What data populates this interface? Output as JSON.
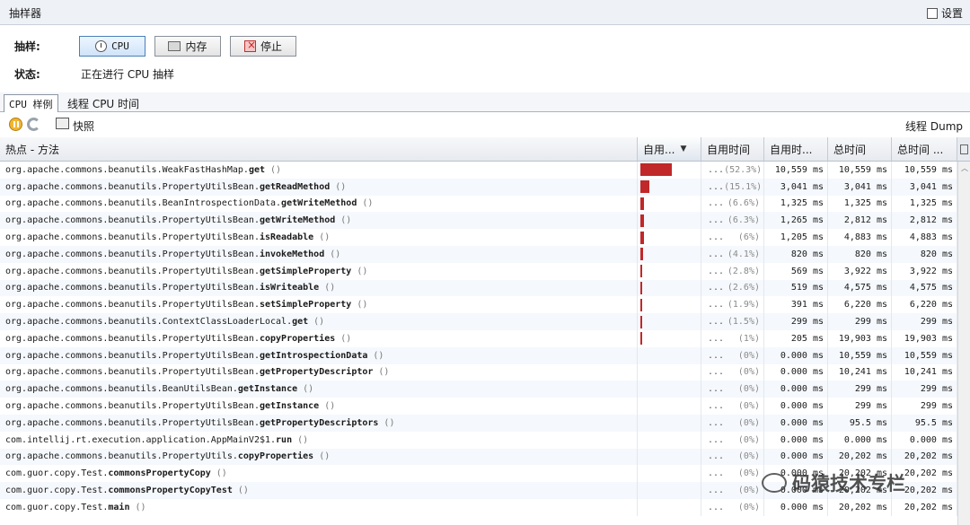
{
  "window": {
    "title": "抽样器",
    "settings_label": "设置"
  },
  "controls": {
    "sampling_label": "抽样:",
    "cpu_button": "CPU",
    "memory_button": "内存",
    "stop_button": "停止",
    "status_label": "状态:",
    "status_value": "正在进行 CPU 抽样"
  },
  "tabs": [
    {
      "label": "CPU 样例",
      "selected": true
    },
    {
      "label": "线程 CPU 时间",
      "selected": false
    }
  ],
  "toolbar": {
    "snapshot_label": "快照",
    "thread_dump_label": "线程 Dump"
  },
  "table": {
    "columns": [
      "热点 - 方法",
      "自用...",
      "自用时间",
      "自用时...",
      "总时间",
      "总时间 ..."
    ],
    "sorted_column": 1,
    "rows": [
      {
        "prefix": "org.apache.commons.beanutils.WeakFastHashMap.",
        "method": "get",
        "pct": "(52.3%)",
        "bar_fraction": 0.523,
        "self_time": "10,559 ms",
        "total_time": "10,559 ms",
        "total_time2": "10,559 ms"
      },
      {
        "prefix": "org.apache.commons.beanutils.PropertyUtilsBean.",
        "method": "getReadMethod",
        "pct": "(15.1%)",
        "bar_fraction": 0.151,
        "self_time": "3,041 ms",
        "total_time": "3,041 ms",
        "total_time2": "3,041 ms"
      },
      {
        "prefix": "org.apache.commons.beanutils.BeanIntrospectionData.",
        "method": "getWriteMethod",
        "pct": "(6.6%)",
        "bar_fraction": 0.066,
        "self_time": "1,325 ms",
        "total_time": "1,325 ms",
        "total_time2": "1,325 ms"
      },
      {
        "prefix": "org.apache.commons.beanutils.PropertyUtilsBean.",
        "method": "getWriteMethod",
        "pct": "(6.3%)",
        "bar_fraction": 0.063,
        "self_time": "1,265 ms",
        "total_time": "2,812 ms",
        "total_time2": "2,812 ms"
      },
      {
        "prefix": "org.apache.commons.beanutils.PropertyUtilsBean.",
        "method": "isReadable",
        "pct": "(6%)",
        "bar_fraction": 0.06,
        "self_time": "1,205 ms",
        "total_time": "4,883 ms",
        "total_time2": "4,883 ms"
      },
      {
        "prefix": "org.apache.commons.beanutils.PropertyUtilsBean.",
        "method": "invokeMethod",
        "pct": "(4.1%)",
        "bar_fraction": 0.041,
        "self_time": "820 ms",
        "total_time": "820 ms",
        "total_time2": "820 ms"
      },
      {
        "prefix": "org.apache.commons.beanutils.PropertyUtilsBean.",
        "method": "getSimpleProperty",
        "pct": "(2.8%)",
        "bar_fraction": 0.028,
        "self_time": "569 ms",
        "total_time": "3,922 ms",
        "total_time2": "3,922 ms"
      },
      {
        "prefix": "org.apache.commons.beanutils.PropertyUtilsBean.",
        "method": "isWriteable",
        "pct": "(2.6%)",
        "bar_fraction": 0.026,
        "self_time": "519 ms",
        "total_time": "4,575 ms",
        "total_time2": "4,575 ms"
      },
      {
        "prefix": "org.apache.commons.beanutils.PropertyUtilsBean.",
        "method": "setSimpleProperty",
        "pct": "(1.9%)",
        "bar_fraction": 0.019,
        "self_time": "391 ms",
        "total_time": "6,220 ms",
        "total_time2": "6,220 ms"
      },
      {
        "prefix": "org.apache.commons.beanutils.ContextClassLoaderLocal.",
        "method": "get",
        "pct": "(1.5%)",
        "bar_fraction": 0.015,
        "self_time": "299 ms",
        "total_time": "299 ms",
        "total_time2": "299 ms"
      },
      {
        "prefix": "org.apache.commons.beanutils.PropertyUtilsBean.",
        "method": "copyProperties",
        "pct": "(1%)",
        "bar_fraction": 0.01,
        "self_time": "205 ms",
        "total_time": "19,903 ms",
        "total_time2": "19,903 ms"
      },
      {
        "prefix": "org.apache.commons.beanutils.PropertyUtilsBean.",
        "method": "getIntrospectionData",
        "pct": "(0%)",
        "bar_fraction": 0,
        "self_time": "0.000 ms",
        "total_time": "10,559 ms",
        "total_time2": "10,559 ms"
      },
      {
        "prefix": "org.apache.commons.beanutils.PropertyUtilsBean.",
        "method": "getPropertyDescriptor",
        "pct": "(0%)",
        "bar_fraction": 0,
        "self_time": "0.000 ms",
        "total_time": "10,241 ms",
        "total_time2": "10,241 ms"
      },
      {
        "prefix": "org.apache.commons.beanutils.BeanUtilsBean.",
        "method": "getInstance",
        "pct": "(0%)",
        "bar_fraction": 0,
        "self_time": "0.000 ms",
        "total_time": "299 ms",
        "total_time2": "299 ms"
      },
      {
        "prefix": "org.apache.commons.beanutils.PropertyUtilsBean.",
        "method": "getInstance",
        "pct": "(0%)",
        "bar_fraction": 0,
        "self_time": "0.000 ms",
        "total_time": "299 ms",
        "total_time2": "299 ms"
      },
      {
        "prefix": "org.apache.commons.beanutils.PropertyUtilsBean.",
        "method": "getPropertyDescriptors",
        "pct": "(0%)",
        "bar_fraction": 0,
        "self_time": "0.000 ms",
        "total_time": "95.5 ms",
        "total_time2": "95.5 ms"
      },
      {
        "prefix": "com.intellij.rt.execution.application.AppMainV2$1.",
        "method": "run",
        "pct": "(0%)",
        "bar_fraction": 0,
        "self_time": "0.000 ms",
        "total_time": "0.000 ms",
        "total_time2": "0.000 ms"
      },
      {
        "prefix": "org.apache.commons.beanutils.PropertyUtils.",
        "method": "copyProperties",
        "pct": "(0%)",
        "bar_fraction": 0,
        "self_time": "0.000 ms",
        "total_time": "20,202 ms",
        "total_time2": "20,202 ms"
      },
      {
        "prefix": "com.guor.copy.Test.",
        "method": "commonsPropertyCopy",
        "pct": "(0%)",
        "bar_fraction": 0,
        "self_time": "0.000 ms",
        "total_time": "20,202 ms",
        "total_time2": "20,202 ms"
      },
      {
        "prefix": "com.guor.copy.Test.",
        "method": "commonsPropertyCopyTest",
        "pct": "(0%)",
        "bar_fraction": 0,
        "self_time": "0.000 ms",
        "total_time": "20,202 ms",
        "total_time2": "20,202 ms"
      },
      {
        "prefix": "com.guor.copy.Test.",
        "method": "main",
        "pct": "(0%)",
        "bar_fraction": 0,
        "self_time": "0.000 ms",
        "total_time": "20,202 ms",
        "total_time2": "20,202 ms"
      }
    ],
    "row_ellipsis": "...",
    "row_paren": "()"
  },
  "watermark": "码猿技术专栏",
  "colors": {
    "bar": "#c0282a",
    "header_bg": "#e7eaef",
    "selection_tab": "#ffffff"
  }
}
